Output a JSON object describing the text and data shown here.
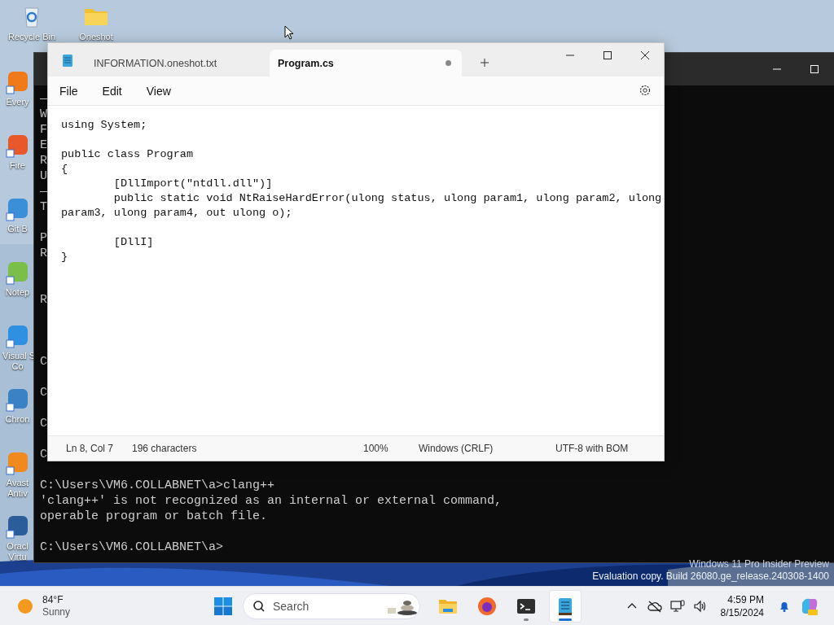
{
  "desktop_icons": [
    {
      "kind": "recycle",
      "label_lines": [
        "Recycle Bin"
      ]
    },
    {
      "kind": "folder",
      "label_lines": [
        "Oneshot"
      ]
    },
    {
      "kind": "everything",
      "label_lines": [
        "Every"
      ]
    },
    {
      "kind": "firefox",
      "label_lines": [
        "Fire"
      ]
    },
    {
      "kind": "git",
      "label_lines": [
        "Git B"
      ]
    },
    {
      "kind": "notepadpp",
      "label_lines": [
        "Notep"
      ]
    },
    {
      "kind": "vscode",
      "label_lines": [
        "Visual S",
        "Co"
      ]
    },
    {
      "kind": "chrome",
      "label_lines": [
        "Chron"
      ]
    },
    {
      "kind": "avast",
      "label_lines": [
        "Avast",
        "Antiv"
      ]
    },
    {
      "kind": "virtualbox",
      "label_lines": [
        "Oracl",
        "Virtu"
      ]
    }
  ],
  "console": {
    "lines": [
      {
        "kind": "text",
        "text": "—"
      },
      {
        "kind": "text",
        "text": "W"
      },
      {
        "kind": "text",
        "text": "F"
      },
      {
        "kind": "text",
        "text": "E"
      },
      {
        "kind": "text",
        "text": "R"
      },
      {
        "kind": "text",
        "text": "U"
      },
      {
        "kind": "text",
        "text": "—"
      },
      {
        "kind": "text",
        "text": "T"
      },
      {
        "kind": "blank"
      },
      {
        "kind": "text",
        "text": "P"
      },
      {
        "kind": "text",
        "text": "R"
      },
      {
        "kind": "blank"
      },
      {
        "kind": "blank"
      },
      {
        "kind": "text",
        "text": "R"
      },
      {
        "kind": "blank"
      },
      {
        "kind": "blank"
      },
      {
        "kind": "blank"
      },
      {
        "kind": "text",
        "text": "C"
      },
      {
        "kind": "blank"
      },
      {
        "kind": "text",
        "text": "C"
      },
      {
        "kind": "blank"
      },
      {
        "kind": "text",
        "text": "C"
      },
      {
        "kind": "blank"
      },
      {
        "kind": "text",
        "text": "C"
      },
      {
        "kind": "blank"
      },
      {
        "kind": "text",
        "text": "C:\\Users\\VM6.COLLABNET\\a>clang++"
      },
      {
        "kind": "text",
        "text": "'clang++' is not recognized as an internal or external command,"
      },
      {
        "kind": "text",
        "text": "operable program or batch file."
      },
      {
        "kind": "blank"
      },
      {
        "kind": "text",
        "text": "C:\\Users\\VM6.COLLABNET\\a>"
      }
    ]
  },
  "notepad": {
    "tabs": [
      {
        "label": "INFORMATION.oneshot.txt",
        "selected": false,
        "unsaved": false
      },
      {
        "label": "Program.cs",
        "selected": true,
        "unsaved": true
      }
    ],
    "menu": [
      "File",
      "Edit",
      "View"
    ],
    "code_lines": [
      {
        "kind": "text",
        "text": "using System;"
      },
      {
        "kind": "blank"
      },
      {
        "kind": "text",
        "text": "public class Program"
      },
      {
        "kind": "text",
        "text": "{"
      },
      {
        "kind": "text",
        "text": "        [DllImport(\"ntdll.dll\")]"
      },
      {
        "kind": "text",
        "text": "        public static void NtRaiseHardError(ulong status, ulong param1, ulong param2, ulong"
      },
      {
        "kind": "text",
        "text": "param3, ulong param4, out ulong o);"
      },
      {
        "kind": "blank"
      },
      {
        "kind": "text",
        "text": "        [DllI]"
      },
      {
        "kind": "text",
        "text": "}"
      }
    ],
    "status_bar": [
      "Ln 8, Col 7",
      "196 characters",
      "100%",
      "Windows (CRLF)",
      "UTF-8 with BOM"
    ]
  },
  "watermark": [
    "Windows 11 Pro Insider Preview",
    "Evaluation copy. Build 26080.ge_release.240308-1400"
  ],
  "taskbar": {
    "weather": {
      "temperature": "84°F",
      "condition": "Sunny"
    },
    "search": {
      "placeholder": "Search"
    },
    "apps": [
      {
        "kind": "explorer",
        "running": false,
        "active": false
      },
      {
        "kind": "firefox",
        "running": false,
        "active": false
      },
      {
        "kind": "terminal",
        "running": true,
        "active": false
      },
      {
        "kind": "notepad",
        "running": true,
        "active": true
      }
    ],
    "clock": {
      "time": "4:59 PM",
      "date": "8/15/2024"
    }
  }
}
